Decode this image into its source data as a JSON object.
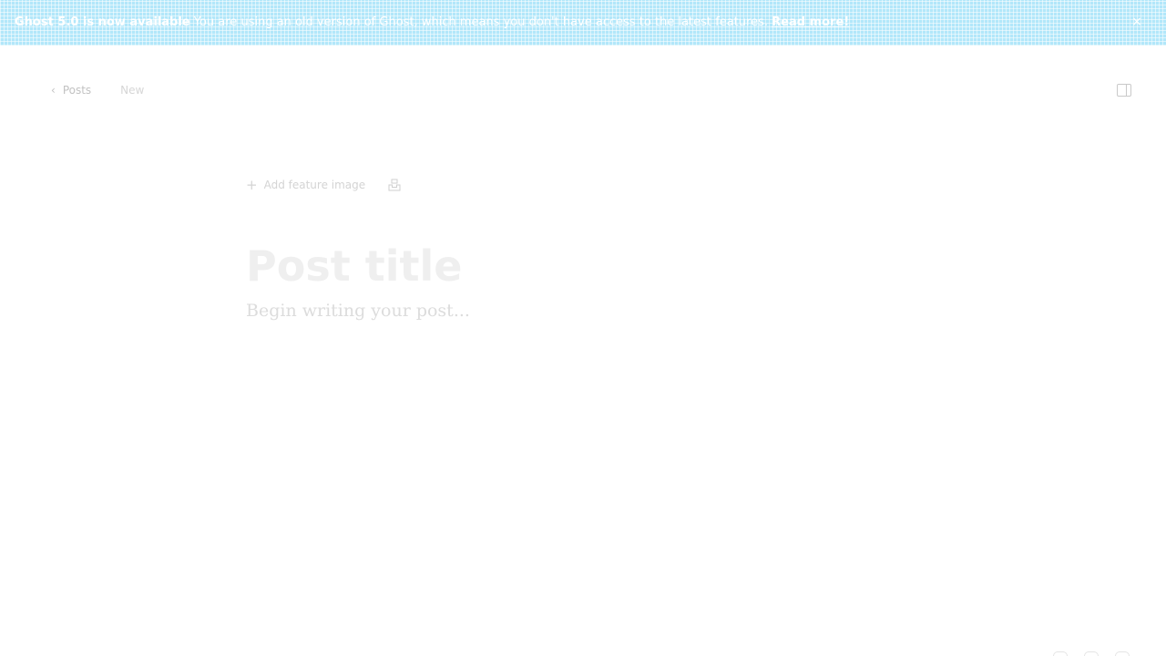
{
  "banner": {
    "headline": "Ghost 5.0 is now available",
    "message": " You are using an old version of Ghost, which means you don't have access to the latest features.",
    "link_label": "Read more!",
    "close_label": "×"
  },
  "breadcrumb": {
    "chevron": "‹",
    "back_label": "Posts",
    "status_label": "New"
  },
  "editor": {
    "add_feature_icon": "+",
    "add_feature_label": "Add feature image",
    "title_placeholder": "Post title",
    "body_placeholder": "Begin writing your post..."
  },
  "colors": {
    "banner_accent": "#14b8f0",
    "muted_text": "#c7c7c7"
  },
  "icons": {
    "sidebar_toggle": "sidebar-toggle-icon",
    "feature_extra": "unsplash-icon",
    "banner_close": "close-icon"
  }
}
